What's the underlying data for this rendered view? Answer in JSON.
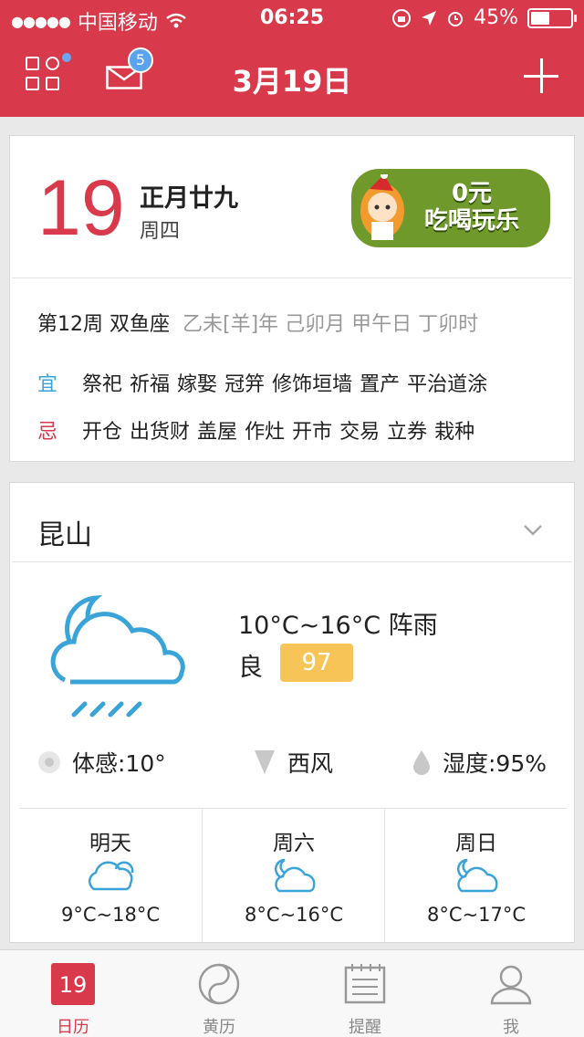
{
  "status": {
    "carrier": "中国移动",
    "time": "06:25",
    "battery": "45%",
    "signal_dots": "●●●●●"
  },
  "header": {
    "title": "3月19日",
    "mail_badge": "5"
  },
  "date_card": {
    "day": "19",
    "lunar_date": "正月廿九",
    "weekday": "周四",
    "promo": {
      "line1": "0元",
      "line2": "吃喝玩乐"
    },
    "week": "第12周 双鱼座",
    "ganzhi": "乙未[羊]年 己卯月 甲午日 丁卯时",
    "yi_label": "宜",
    "yi_items": [
      "祭祀",
      "祈福",
      "嫁娶",
      "冠笄",
      "修饰垣墙",
      "置产",
      "平治道涂"
    ],
    "ji_label": "忌",
    "ji_items": [
      "开仓",
      "出货财",
      "盖屋",
      "作灶",
      "开市",
      "交易",
      "立券",
      "栽种"
    ]
  },
  "weather": {
    "city": "昆山",
    "temp_range": "10°C~16°C 阵雨",
    "air_quality_label": "良",
    "aqi": "97",
    "feels_like": "体感:10°",
    "wind": "西风",
    "humidity": "湿度:95%",
    "forecast": [
      {
        "day": "明天",
        "temp": "9°C~18°C"
      },
      {
        "day": "周六",
        "temp": "8°C~16°C"
      },
      {
        "day": "周日",
        "temp": "8°C~17°C"
      }
    ]
  },
  "tabs": [
    {
      "label": "日历",
      "icon_text": "19"
    },
    {
      "label": "黄历"
    },
    {
      "label": "提醒"
    },
    {
      "label": "我"
    }
  ],
  "colors": {
    "brand": "#d83a4b",
    "weather_icon": "#3aa4d8",
    "aqi": "#f7c557"
  }
}
